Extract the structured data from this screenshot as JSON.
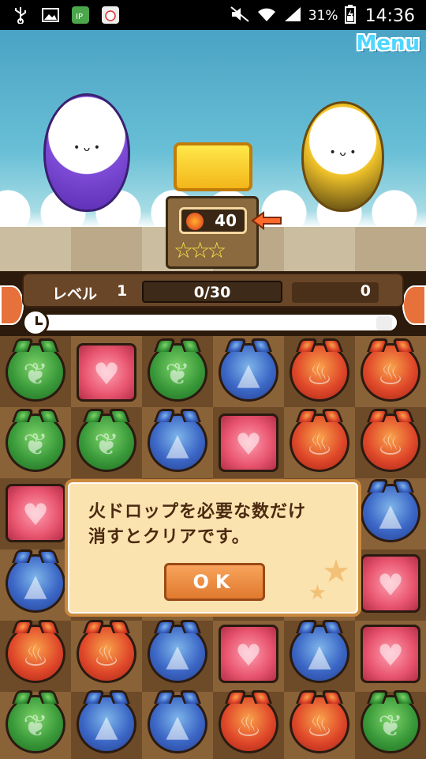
{
  "status_bar": {
    "battery_percent": "31%",
    "time": "14:36",
    "icons": [
      "usb-icon",
      "image-icon",
      "ip-app-icon",
      "cat-app-icon",
      "mute-icon",
      "wifi-icon",
      "signal-icon",
      "battery-icon"
    ]
  },
  "header": {
    "menu_label": "Menu"
  },
  "goal": {
    "drop_count": "40",
    "drop_type": "fire"
  },
  "hud": {
    "level_label": "レベル",
    "level_value": "1",
    "progress_text": "0/30",
    "score": "0",
    "timer_fraction": 1.0
  },
  "board": {
    "rows": [
      [
        "wood",
        "heart",
        "wood",
        "water",
        "fire",
        "fire"
      ],
      [
        "wood",
        "wood",
        "water",
        "heart",
        "fire",
        "fire"
      ],
      [
        "heart",
        "",
        "",
        "",
        "",
        "water"
      ],
      [
        "water",
        "",
        "",
        "",
        "",
        "heart"
      ],
      [
        "fire",
        "fire",
        "water",
        "heart",
        "water",
        "heart"
      ],
      [
        "wood",
        "water",
        "water",
        "fire",
        "fire",
        "wood"
      ]
    ]
  },
  "dialog": {
    "message_line1": "火ドロップを必要な数だけ",
    "message_line2": "消すとクリアです。",
    "ok_label": "OK"
  },
  "colors": {
    "hud_bg": "#2c1a0c",
    "dialog_bg": "#fbe3b0",
    "ok_button": "#e07a2e"
  }
}
